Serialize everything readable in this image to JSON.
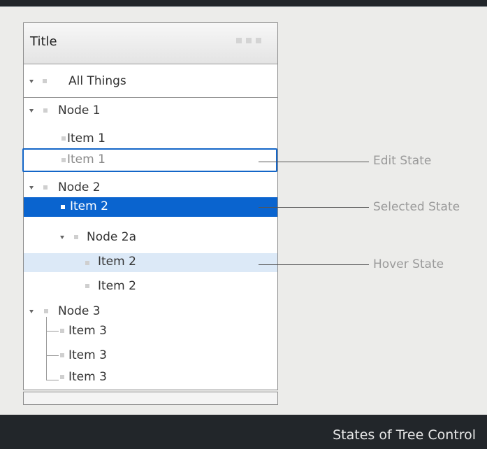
{
  "panel": {
    "title": "Title",
    "grip_icon": "grip-dots-icon"
  },
  "tree": {
    "root": "All Things",
    "node1": "Node 1",
    "node1_item": "Item 1",
    "node1_item_edit": "Item 1",
    "node2": "Node 2",
    "node2_item_selected": "Item 2",
    "node2a": "Node 2a",
    "node2a_item_hover": "Item 2",
    "node2a_item": "Item 2",
    "node3": "Node 3",
    "node3_items": [
      "Item 3",
      "Item 3",
      "Item 3"
    ]
  },
  "callouts": {
    "edit": "Edit State",
    "selected": "Selected State",
    "hover": "Hover State"
  },
  "footer": {
    "caption": "States of  Tree Control"
  },
  "colors": {
    "selected": "#0a64cf",
    "hover": "#dce9f7",
    "edit_border": "#1466c8",
    "dark_bar": "#22262a"
  }
}
